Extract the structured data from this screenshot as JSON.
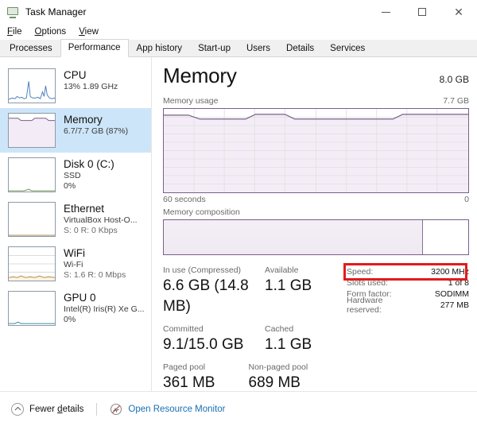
{
  "window": {
    "title": "Task Manager",
    "icon": "task-manager-icon",
    "controls": {
      "minimize": "–",
      "maximize": "□",
      "close": "✕"
    }
  },
  "menubar": {
    "items": [
      "File",
      "Options",
      "View"
    ]
  },
  "tabs": {
    "items": [
      {
        "label": "Processes",
        "active": false
      },
      {
        "label": "Performance",
        "active": true
      },
      {
        "label": "App history",
        "active": false
      },
      {
        "label": "Start-up",
        "active": false
      },
      {
        "label": "Users",
        "active": false
      },
      {
        "label": "Details",
        "active": false
      },
      {
        "label": "Services",
        "active": false
      }
    ]
  },
  "sidebar": {
    "items": [
      {
        "name": "CPU",
        "sub1": "13%  1.89 GHz",
        "sub2": "",
        "selected": false,
        "graph": "cpu"
      },
      {
        "name": "Memory",
        "sub1": "6.7/7.7 GB (87%)",
        "sub2": "",
        "selected": true,
        "graph": "memory"
      },
      {
        "name": "Disk 0 (C:)",
        "sub1": "SSD",
        "sub2": "0%",
        "selected": false,
        "graph": "disk"
      },
      {
        "name": "Ethernet",
        "sub1": "VirtualBox Host-O...",
        "sub2": "S: 0 R: 0 Kbps",
        "selected": false,
        "graph": "ethernet"
      },
      {
        "name": "WiFi",
        "sub1": "Wi-Fi",
        "sub2": "S: 1.6 R: 0 Mbps",
        "selected": false,
        "graph": "wifi"
      },
      {
        "name": "GPU 0",
        "sub1": "Intel(R) Iris(R) Xe G...",
        "sub2": "0%",
        "selected": false,
        "graph": "gpu"
      }
    ]
  },
  "main": {
    "title": "Memory",
    "capacity": "8.0 GB",
    "usage_label": "Memory usage",
    "usage_max": "7.7 GB",
    "axis_left": "60 seconds",
    "axis_right": "0",
    "composition_label": "Memory composition",
    "composition_used_percent": 85,
    "stats": [
      {
        "label": "In use (Compressed)",
        "value": "6.6 GB (14.8 MB)"
      },
      {
        "label": "Available",
        "value": "1.1 GB"
      },
      {
        "label": "Committed",
        "value": "9.1/15.0 GB"
      },
      {
        "label": "Cached",
        "value": "1.1 GB"
      },
      {
        "label": "Paged pool",
        "value": "361 MB"
      },
      {
        "label": "Non-paged pool",
        "value": "689 MB"
      }
    ],
    "details": [
      {
        "label": "Speed:",
        "value": "3200 MHz",
        "highlighted": true
      },
      {
        "label": "Slots used:",
        "value": "1 of 8",
        "highlighted": false
      },
      {
        "label": "Form factor:",
        "value": "SODIMM",
        "highlighted": false
      },
      {
        "label": "Hardware reserved:",
        "value": "277 MB",
        "highlighted": false
      }
    ]
  },
  "footer": {
    "fewer_details": "Fewer details",
    "fewer_icon": "chevron-up-circle-icon",
    "resource_monitor": "Open Resource Monitor",
    "resource_icon": "resource-monitor-icon"
  },
  "colors": {
    "accent": "#1a6fb5",
    "selection": "#cde5f8",
    "memory_line": "#7a5f8a",
    "memory_fill": "#f3ecf6",
    "highlight_box": "#e21b1b",
    "cpu_line": "#4a7ebb"
  },
  "chart_data": {
    "type": "area",
    "title": "Memory usage",
    "ylabel": "",
    "xlabel": "60 seconds",
    "ylim": [
      0,
      7.7
    ],
    "xlim": [
      60,
      0
    ],
    "grid": true,
    "series": [
      {
        "name": "Memory in use (GB)",
        "x": [
          60,
          56,
          52,
          48,
          44,
          40,
          36,
          32,
          28,
          24,
          20,
          16,
          12,
          8,
          4,
          0
        ],
        "values": [
          6.85,
          6.8,
          6.62,
          6.6,
          6.6,
          6.6,
          6.6,
          6.78,
          6.8,
          6.66,
          6.6,
          6.6,
          6.6,
          6.62,
          6.85,
          6.85
        ]
      }
    ],
    "annotations": [
      "7.7 GB",
      "0"
    ]
  }
}
